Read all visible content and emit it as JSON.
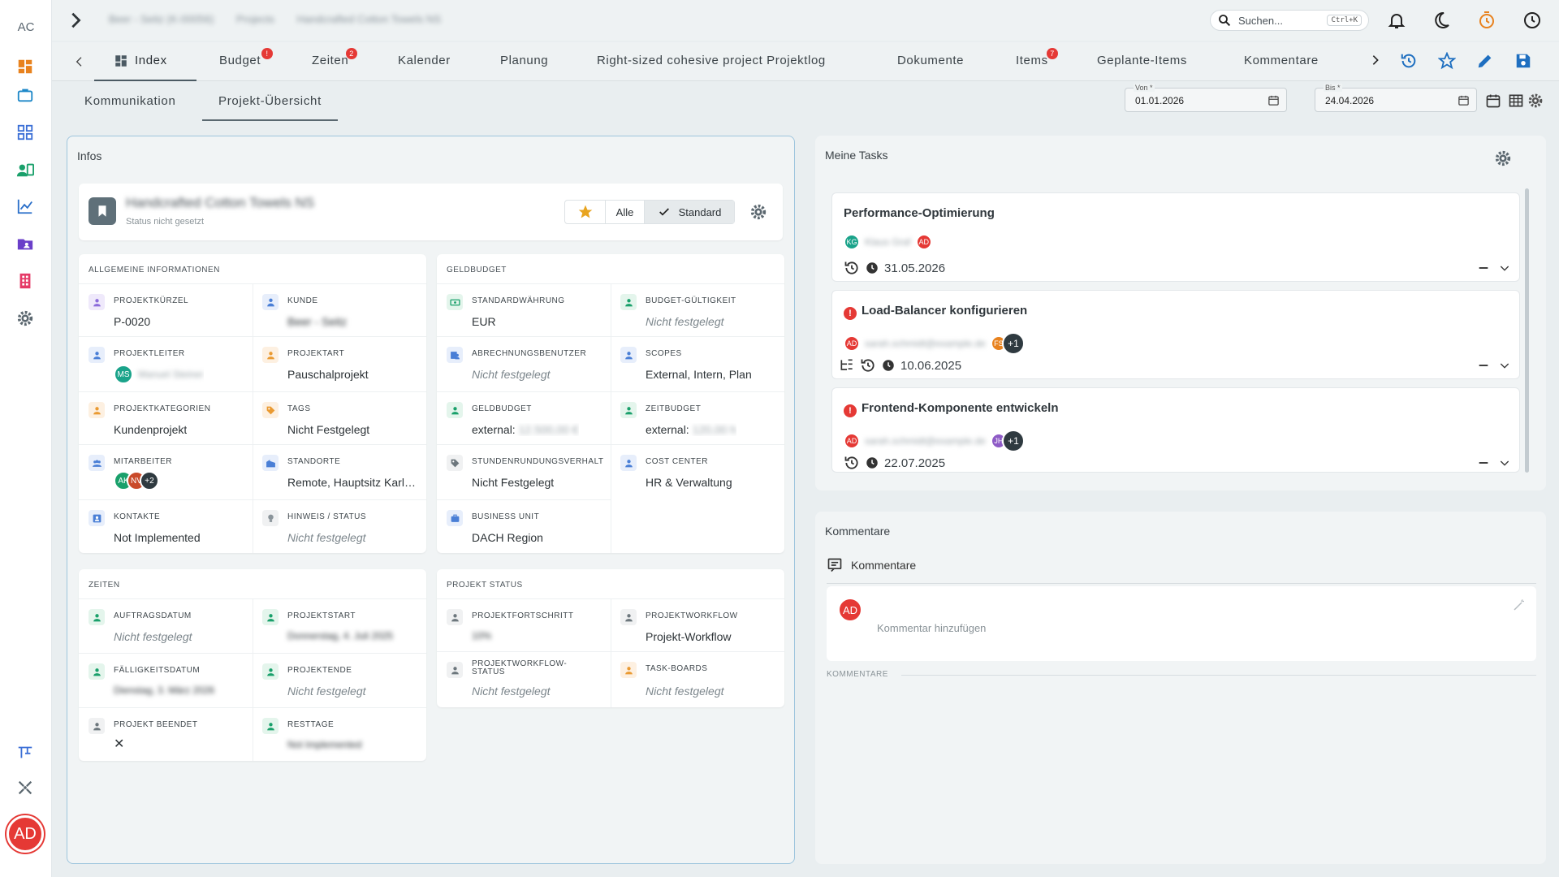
{
  "sidebar": {
    "logo": "AC",
    "avatar": "AD",
    "items": [
      {
        "name": "dashboard-icon"
      },
      {
        "name": "briefcase-icon"
      },
      {
        "name": "widgets-icon"
      },
      {
        "name": "contacts-icon"
      },
      {
        "name": "chart-line-icon"
      },
      {
        "name": "folder-user-icon"
      },
      {
        "name": "building-icon"
      },
      {
        "name": "settings-icon"
      }
    ]
  },
  "header": {
    "breadcrumbs": [
      "Beer - Seitz (K-00056)",
      "Projects",
      "Handcrafted Cotton Towels NS"
    ],
    "search_placeholder": "Suchen...",
    "search_shortcut": "Ctrl+K"
  },
  "tabs": {
    "items": [
      {
        "label": "Index",
        "badge": ""
      },
      {
        "label": "Budget",
        "badge": "!"
      },
      {
        "label": "Zeiten",
        "badge": "2"
      },
      {
        "label": "Kalender",
        "badge": ""
      },
      {
        "label": "Planung",
        "badge": ""
      },
      {
        "label": "Right-sized cohesive project Projektlog",
        "badge": ""
      },
      {
        "label": "Dokumente",
        "badge": ""
      },
      {
        "label": "Items",
        "badge": "7"
      },
      {
        "label": "Geplante-Items",
        "badge": ""
      },
      {
        "label": "Kommentare",
        "badge": ""
      }
    ]
  },
  "subtabs": [
    "Kommunikation",
    "Projekt-Übersicht"
  ],
  "dates": {
    "from_label": "Von *",
    "from_value": "01.01.2026",
    "to_label": "Bis *",
    "to_value": "24.04.2026"
  },
  "infos": {
    "title": "Infos",
    "project_name": "Handcrafted Cotton Towels NS",
    "project_status": "Status nicht gesetzt",
    "filter_all": "Alle",
    "filter_standard": "Standard",
    "general": {
      "header": "Allgemeine Informationen",
      "projektkuerzel_label": "Projektkürzel",
      "projektkuerzel": "P-0020",
      "kunde_label": "Kunde",
      "kunde": "Beer - Seitz",
      "projektleiter_label": "Projektleiter",
      "projektleiter_initials": "MS",
      "projektleiter": "Manuel Steiner",
      "projektart_label": "Projektart",
      "projektart": "Pauschalprojekt",
      "kategorien_label": "Projektkategorien",
      "kategorien": "Kundenprojekt",
      "tags_label": "Tags",
      "tags": "Nicht Festgelegt",
      "mitarbeiter_label": "Mitarbeiter",
      "mitarbeiter_a1": "AK",
      "mitarbeiter_a2": "NV",
      "mitarbeiter_more": "+2",
      "standorte_label": "Standorte",
      "standorte": "Remote, Hauptsitz Karlsruhe",
      "kontakte_label": "Kontakte",
      "kontakte": "Not Implemented",
      "hinweis_label": "Hinweis / Status",
      "hinweis": "Nicht festgelegt"
    },
    "budget": {
      "header": "Geldbudget",
      "waehrung_label": "Standardwährung",
      "waehrung": "EUR",
      "gueltigkeit_label": "Budget-Gültigkeit",
      "gueltigkeit": "Nicht festgelegt",
      "abrechnung_label": "Abrechnungsbenutzer",
      "abrechnung": "Nicht festgelegt",
      "scopes_label": "Scopes",
      "scopes": "External, Intern, Plan",
      "geldbudget_label": "Geldbudget",
      "geldbudget_prefix": "external:",
      "geldbudget_value": "12.500,00 €",
      "zeitbudget_label": "Zeitbudget",
      "zeitbudget_prefix": "external:",
      "zeitbudget_value": "120,00 h",
      "rundung_label": "Stundenrundungsverhalt",
      "rundung": "Nicht Festgelegt",
      "costcenter_label": "Cost Center",
      "costcenter": "HR & Verwaltung",
      "bu_label": "Business Unit",
      "bu": "DACH Region"
    },
    "zeiten": {
      "header": "Zeiten",
      "auftrag_label": "Auftragsdatum",
      "auftrag": "Nicht festgelegt",
      "start_label": "Projektstart",
      "start": "Donnerstag, 4. Juli 2025",
      "faellig_label": "Fälligkeitsdatum",
      "faellig": "Dienstag, 3. März 2026",
      "ende_label": "Projektende",
      "ende": "Nicht festgelegt",
      "beendet_label": "Projekt beendet",
      "beendet": "✕",
      "rest_label": "Resttage",
      "rest": "Not Implemented"
    },
    "status": {
      "header": "Projekt Status",
      "fortschritt_label": "Projektfortschritt",
      "fortschritt": "10%",
      "workflow_label": "Projektworkflow",
      "workflow": "Projekt-Workflow",
      "wfstatus_label": "Projektworkflow-Status",
      "wfstatus": "Nicht festgelegt",
      "boards_label": "Task-Boards",
      "boards": "Nicht festgelegt"
    }
  },
  "tasks": {
    "title": "Meine Tasks",
    "items": [
      {
        "title": "Performance-Optimierung",
        "urgent": false,
        "a1": "KG",
        "assignee": "Klaus Graf",
        "a2": "AD",
        "more": "",
        "due": "31.05.2026"
      },
      {
        "title": "Load-Balancer konfigurieren",
        "urgent": true,
        "a1": "AD",
        "assignee": "sarah.schmidt@example.de",
        "a2": "FS",
        "more": "+1",
        "due": "10.06.2025"
      },
      {
        "title": "Frontend-Komponente entwickeln",
        "urgent": true,
        "a1": "AD",
        "assignee": "sarah.schmidt@example.de",
        "a2": "JH",
        "more": "+1",
        "due": "22.07.2025"
      }
    ]
  },
  "comments": {
    "title": "Kommentare",
    "subheader": "Kommentare",
    "avatar": "AD",
    "placeholder": "Kommentar hinzufügen",
    "section_label": "KOMMENTARE"
  }
}
